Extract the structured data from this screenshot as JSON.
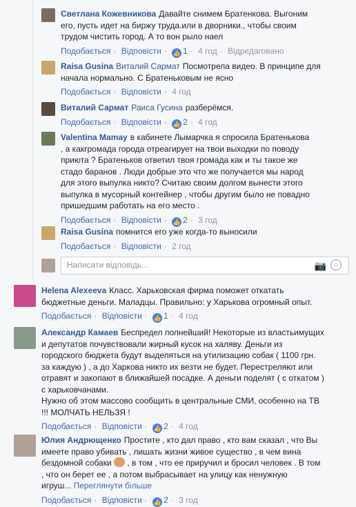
{
  "actions": {
    "like": "Подобається",
    "reply": "Відповісти"
  },
  "replies": [
    {
      "author": "Светлана Кожевникова",
      "mention": "",
      "lines": [
        "Давайте снимем Братенкова. Выгоним",
        "его, пусть идет на биржу труда.или в дворники., чтобы своим",
        "трудом чистить город. А то вон рыло наел"
      ],
      "likes": "1",
      "time": "4 год",
      "edited": "Відредаговано",
      "avatar_color": "#7a6a60"
    },
    {
      "author": "Raisa Gusina",
      "mention": "Виталий Сармат",
      "lines": [
        "Посмотрела видео. В принципе для",
        "начала нормально. С Братеньковым не ясно"
      ],
      "likes": "",
      "time": "4 год",
      "edited": "",
      "avatar_color": "#c8a86a"
    },
    {
      "author": "Виталий Сармат",
      "mention": "Раиса Гусина",
      "lines": [
        "разберёмся."
      ],
      "likes": "2",
      "time": "4 год",
      "edited": "",
      "avatar_color": "#5a4a40"
    },
    {
      "author": "Valentina Mamay",
      "mention": "",
      "lines": [
        "в кабинете Лымарчка я спросила Братенькова",
        ", а какгромада города отреагирует на твои выходки по поводу",
        "приюта ? Братеньков ответил твоя громада как и ты такое же",
        "стадо баранов . Люди добрые это что же получается мы народ",
        "для этого выпулка никто? Считаю своим долгом вынести этого",
        "выпулка в мусорный контейнер , чтобы другим было не повадно",
        "пришедшим работать на его место ."
      ],
      "likes": "2",
      "time": "3 год",
      "edited": "",
      "avatar_color": "#6a7a5a"
    },
    {
      "author": "Raisa Gusina",
      "mention": "",
      "lines": [
        "помнится его уже когда-то выносили"
      ],
      "likes": "",
      "time": "2 год",
      "edited": "",
      "avatar_color": "#c8a86a"
    }
  ],
  "reply_box": {
    "placeholder": "Написати відповідь..."
  },
  "comments": [
    {
      "author": "Helena Alexeeva",
      "lines": [
        "Класс. Харьковская фирма поможет откатать",
        "бюджетные деньги. Маладцы. Правильно: у Харькова огромный опыт."
      ],
      "likes": "1",
      "time": "4 год",
      "avatar_color": "#c84a8a"
    },
    {
      "author": "Александр Камаев",
      "lines": [
        "Беспредел полнейший! Некоторые из властьимущих",
        "и депутатов почувствовали жирный кусок на халяву. Деньги из",
        "городского бюджета будут выделяться на утилизацию собак ( 1100 грн.",
        "за каждую ) , а до Харкова никто их везти не будет. Перестреляют или",
        "отравят и закопают в ближайшей посадке. А деньги поделят ( с откатом )",
        "с харьковчанами.",
        "Нужно об этом массово сообщить в центральные СМИ, особенно на ТВ",
        "!!! МОЛЧАТЬ НЕЛЬЗЯ !"
      ],
      "likes": "2",
      "time": "4 год",
      "avatar_color": "#8a9a8a"
    },
    {
      "author": "Юлия Андрющенко",
      "lines": [
        "Простите , кто дал право , кто вам сказал , что Вы",
        "имеете право убивать , лишать жизни живое существо , в чем вина",
        "бездомной собаки",
        ", в том , что ее приручил и бросил человек . В том",
        ", что он берет ее , а потом выбрасывает на улицу как ненужную",
        "игруш..."
      ],
      "more": "Переглянути більше",
      "likes": "2",
      "time": "3 год",
      "avatar_color": "#b0a098"
    }
  ]
}
